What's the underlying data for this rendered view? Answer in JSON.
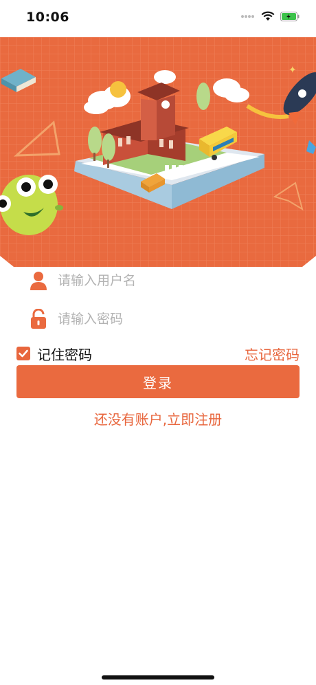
{
  "status_bar": {
    "time": "10:06"
  },
  "login_form": {
    "username_placeholder": "请输入用户名",
    "password_placeholder": "请输入密码",
    "remember_label": "记住密码",
    "remember_checked": true,
    "forgot_label": "忘记密码",
    "login_label": "登录",
    "register_label": "还没有账户,立即注册"
  },
  "colors": {
    "brand": "#ea6a3f",
    "hero_background": "#e96a3f",
    "placeholder": "#b3b3b3"
  },
  "icons": [
    "wifi-icon",
    "battery-icon",
    "user-icon",
    "lock-icon",
    "check-icon"
  ]
}
